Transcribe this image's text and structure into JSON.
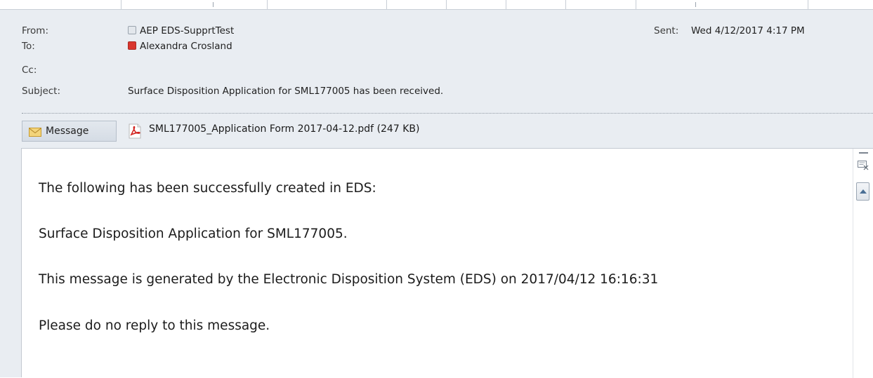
{
  "header": {
    "from_label": "From:",
    "from_value": "AEP EDS-SupprtTest",
    "to_label": "To:",
    "to_value": "Alexandra Crosland",
    "cc_label": "Cc:",
    "cc_value": "",
    "subject_label": "Subject:",
    "subject_value": "Surface Disposition Application for SML177005 has been received.",
    "sent_label": "Sent:",
    "sent_value": "Wed 4/12/2017 4:17 PM"
  },
  "attachments": {
    "message_tab_label": "Message",
    "file_label": "SML177005_Application Form 2017-04-12.pdf (247 KB)"
  },
  "body": {
    "lines": [
      "The following has been successfully created in EDS:",
      "Surface Disposition Application for SML177005.",
      "This message is generated by the Electronic Disposition System (EDS) on 2017/04/12 16:16:31",
      "Please do no reply to this message."
    ]
  },
  "icons": {
    "from_presence": "presence-offline-icon",
    "to_presence": "presence-busy-icon",
    "message_tab": "envelope-icon",
    "attachment": "pdf-icon",
    "scroll_menu": "scroll-menu-icon",
    "scroll_up": "scroll-up-arrow-icon"
  },
  "colors": {
    "header_bg": "#e9edf2",
    "busy_presence": "#d9362e",
    "pdf_red": "#d2231f",
    "envelope": "#f0c85a"
  }
}
